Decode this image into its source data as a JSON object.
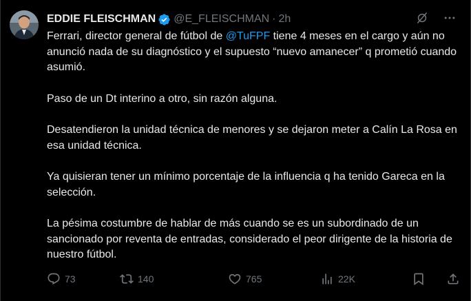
{
  "author": {
    "display_name": "EDDIE FLEISCHMAN",
    "handle": "@E_FLEISCHMAN",
    "separator": "·",
    "time": "2h",
    "verified": true
  },
  "tweet": {
    "paragraphs": [
      {
        "prefix": "Ferrari, director general de fútbol de ",
        "mention": "@TuFPF",
        "suffix": " tiene 4 meses en el cargo y aún no anunció nada de su diagnóstico y el supuesto “nuevo amanecer” q prometió cuando asumió."
      },
      {
        "text": "Paso de un Dt interino a otro, sin razón alguna."
      },
      {
        "text": "Desatendieron la unidad técnica de menores y se dejaron meter a Calín La Rosa en esa unidad técnica."
      },
      {
        "text": "Ya quisieran tener un mínimo porcentaje de la influencia q ha tenido Gareca en la selección."
      },
      {
        "text": "La pésima costumbre de hablar de más cuando se es un subordinado de un sancionado por reventa de entradas, considerado el peor dirigente de la historia de nuestro fútbol."
      }
    ]
  },
  "actions": {
    "replies": "73",
    "retweets": "140",
    "likes": "765",
    "views": "22K"
  },
  "icons": {
    "verified": "verified-badge-icon",
    "grok": "grok-icon",
    "more": "more-options-icon",
    "reply": "reply-icon",
    "retweet": "retweet-icon",
    "like": "heart-icon",
    "views": "views-chart-icon",
    "bookmark": "bookmark-icon",
    "share": "share-icon"
  },
  "colors": {
    "background": "#000000",
    "text_primary": "#e7e9ea",
    "text_secondary": "#71767b",
    "accent": "#1d9bf0"
  }
}
